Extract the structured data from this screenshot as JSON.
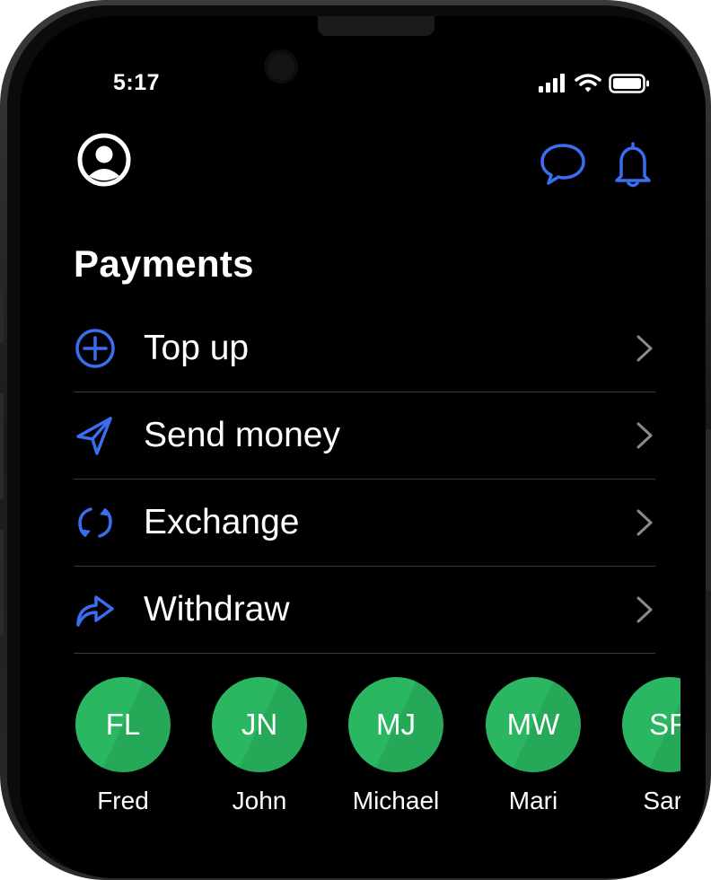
{
  "status_bar": {
    "time": "5:17"
  },
  "section": {
    "title": "Payments"
  },
  "menu": [
    {
      "label": "Top up",
      "icon": "plus-circle-icon"
    },
    {
      "label": "Send money",
      "icon": "send-icon"
    },
    {
      "label": "Exchange",
      "icon": "exchange-icon"
    },
    {
      "label": "Withdraw",
      "icon": "forward-arrow-icon"
    }
  ],
  "contacts": [
    {
      "initials": "FL",
      "name": "Fred"
    },
    {
      "initials": "JN",
      "name": "John"
    },
    {
      "initials": "MJ",
      "name": "Michael"
    },
    {
      "initials": "MW",
      "name": "Mari"
    },
    {
      "initials": "SR",
      "name": "Sara"
    }
  ],
  "colors": {
    "accent": "#3a6df0",
    "avatar_green": "#2bb661",
    "background": "#000000",
    "text": "#ffffff",
    "divider": "#3a3a3a"
  }
}
